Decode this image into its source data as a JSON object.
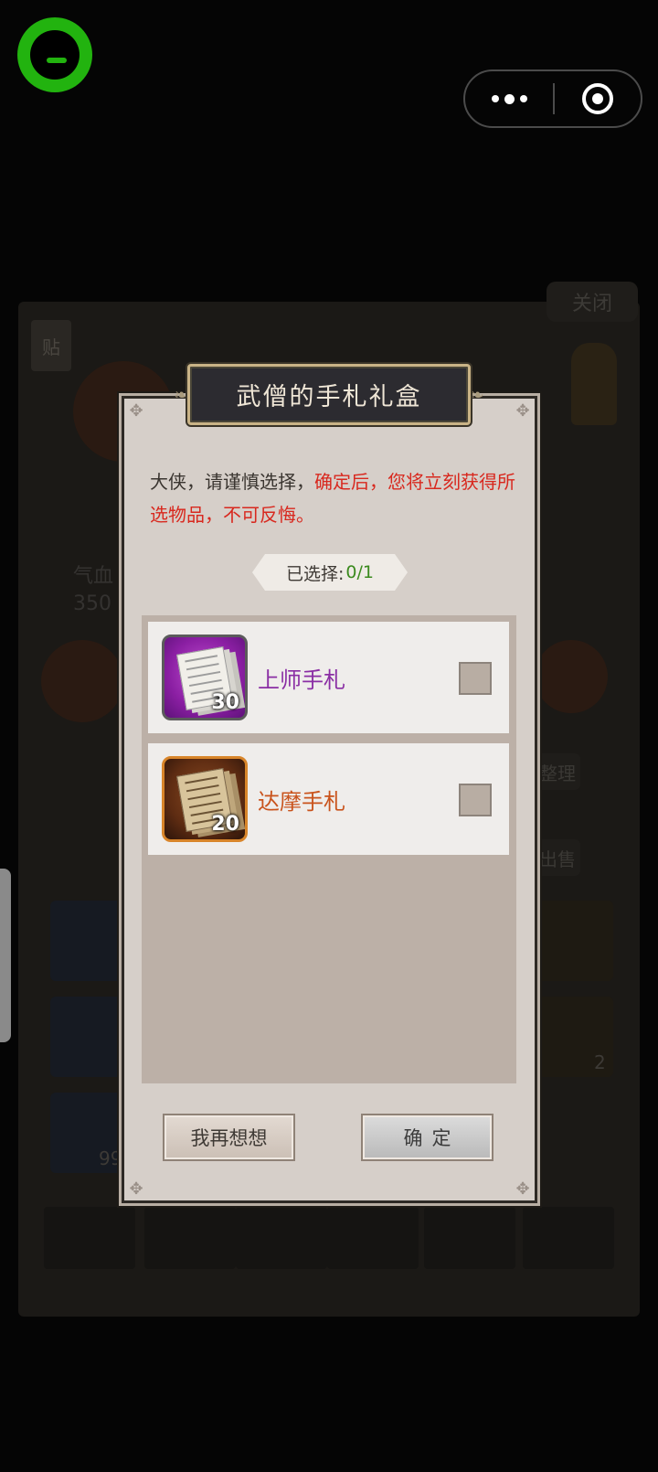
{
  "app_header": {
    "more_icon": "more-dots-icon",
    "close_icon": "target-circle-icon"
  },
  "background": {
    "close_label": "关闭",
    "tag_label": "贴",
    "text_left": "气血",
    "text_left2": "350",
    "btn_right": "整理",
    "btn_right2": "出售",
    "num_2": "2",
    "num_99": "99"
  },
  "dialog": {
    "title": "武僧的手札礼盒",
    "notice_normal": "大侠，请谨慎选择，",
    "notice_warning": "确定后，您将立刻获得所选物品，不可反悔。",
    "selected_label": "已选择:",
    "selected_count": "0/1",
    "items": [
      {
        "name": "上师手札",
        "quantity": "30",
        "icon": "purple-manuscript-icon",
        "checked": false,
        "color": "#8a2ea4"
      },
      {
        "name": "达摩手札",
        "quantity": "20",
        "icon": "orange-manuscript-icon",
        "checked": false,
        "color": "#c9531c"
      }
    ],
    "cancel_label": "我再想想",
    "confirm_label": "确定"
  },
  "colors": {
    "logo_green": "#22b30f",
    "warning_red": "#d8281e",
    "count_green": "#3b8a1e",
    "dialog_bg": "#d6cfc9"
  }
}
